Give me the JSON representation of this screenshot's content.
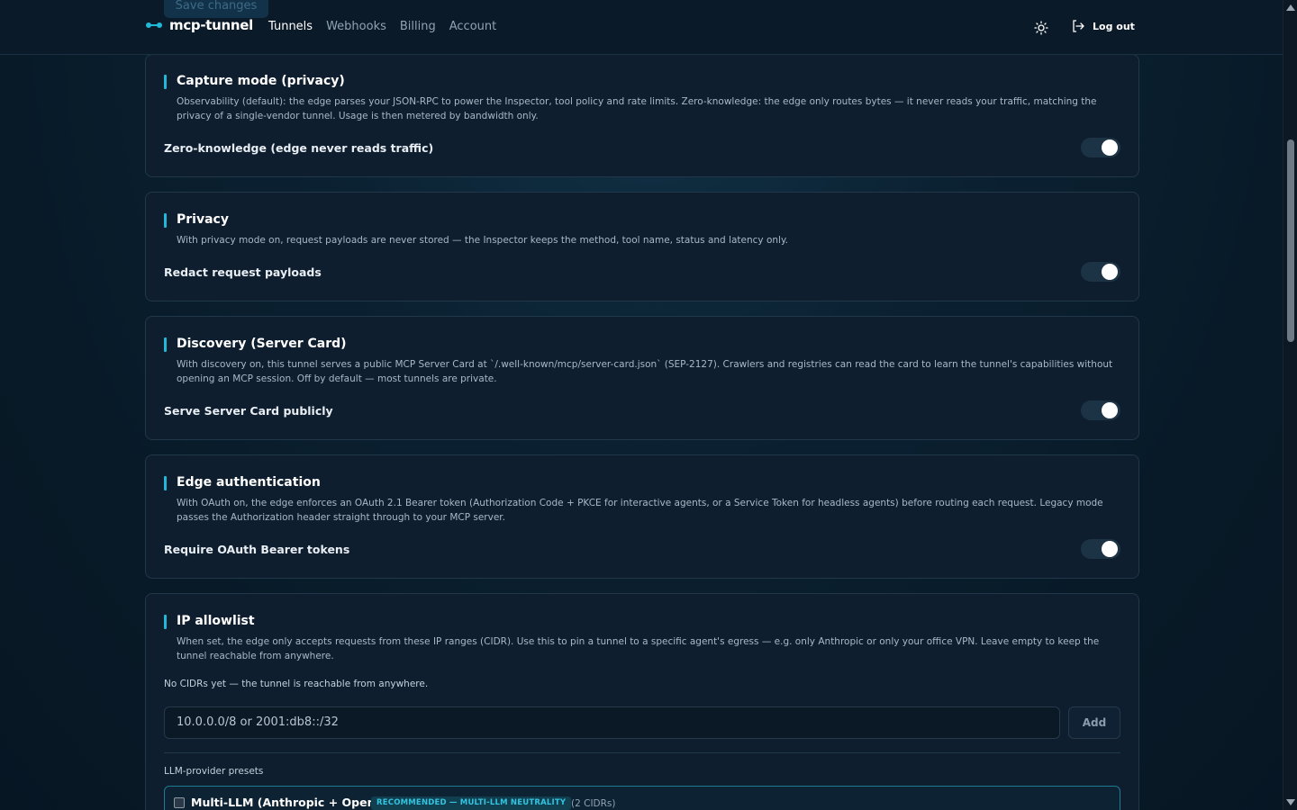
{
  "header": {
    "ghost_button": "Save changes",
    "brand": "mcp-tunnel",
    "nav": [
      "Tunnels",
      "Webhooks",
      "Billing",
      "Account"
    ],
    "active_nav": "Tunnels",
    "theme_icon": "sun-icon",
    "logout_label": "Log out"
  },
  "sections": {
    "capture": {
      "title": "Capture mode (privacy)",
      "description": "Observability (default): the edge parses your JSON-RPC to power the Inspector, tool policy and rate limits. Zero-knowledge: the edge only routes bytes — it never reads your traffic, matching the privacy of a single-vendor tunnel. Usage is then metered by bandwidth only.",
      "row_label": "Zero-knowledge (edge never reads traffic)",
      "toggle_on": true
    },
    "privacy": {
      "title": "Privacy",
      "description": "With privacy mode on, request payloads are never stored — the Inspector keeps the method, tool name, status and latency only.",
      "row_label": "Redact request payloads",
      "toggle_on": true
    },
    "discovery": {
      "title": "Discovery (Server Card)",
      "description": "With discovery on, this tunnel serves a public MCP Server Card at `/.well-known/mcp/server-card.json` (SEP-2127). Crawlers and registries can read the card to learn the tunnel's capabilities without opening an MCP session. Off by default — most tunnels are private.",
      "row_label": "Serve Server Card publicly",
      "toggle_on": true
    },
    "edge_auth": {
      "title": "Edge authentication",
      "description": "With OAuth on, the edge enforces an OAuth 2.1 Bearer token (Authorization Code + PKCE for interactive agents, or a Service Token for headless agents) before routing each request. Legacy mode passes the Authorization header straight through to your MCP server.",
      "row_label": "Require OAuth Bearer tokens",
      "toggle_on": true
    },
    "ip_allowlist": {
      "title": "IP allowlist",
      "description": "When set, the edge only accepts requests from these IP ranges (CIDR). Use this to pin a tunnel to a specific agent's egress — e.g. only Anthropic or only your office VPN. Leave empty to keep the tunnel reachable from anywhere.",
      "empty_note": "No CIDRs yet — the tunnel is reachable from anywhere.",
      "input_placeholder": "10.0.0.0/8 or 2001:db8::/32",
      "add_label": "Add",
      "presets_label": "LLM-provider presets",
      "presets": [
        {
          "name": "Multi-LLM (Anthropic + OpenAI)",
          "badge": "RECOMMENDED — MULTI-LLM NEUTRALITY",
          "count": "(2 CIDRs)",
          "checked": false
        }
      ]
    }
  }
}
